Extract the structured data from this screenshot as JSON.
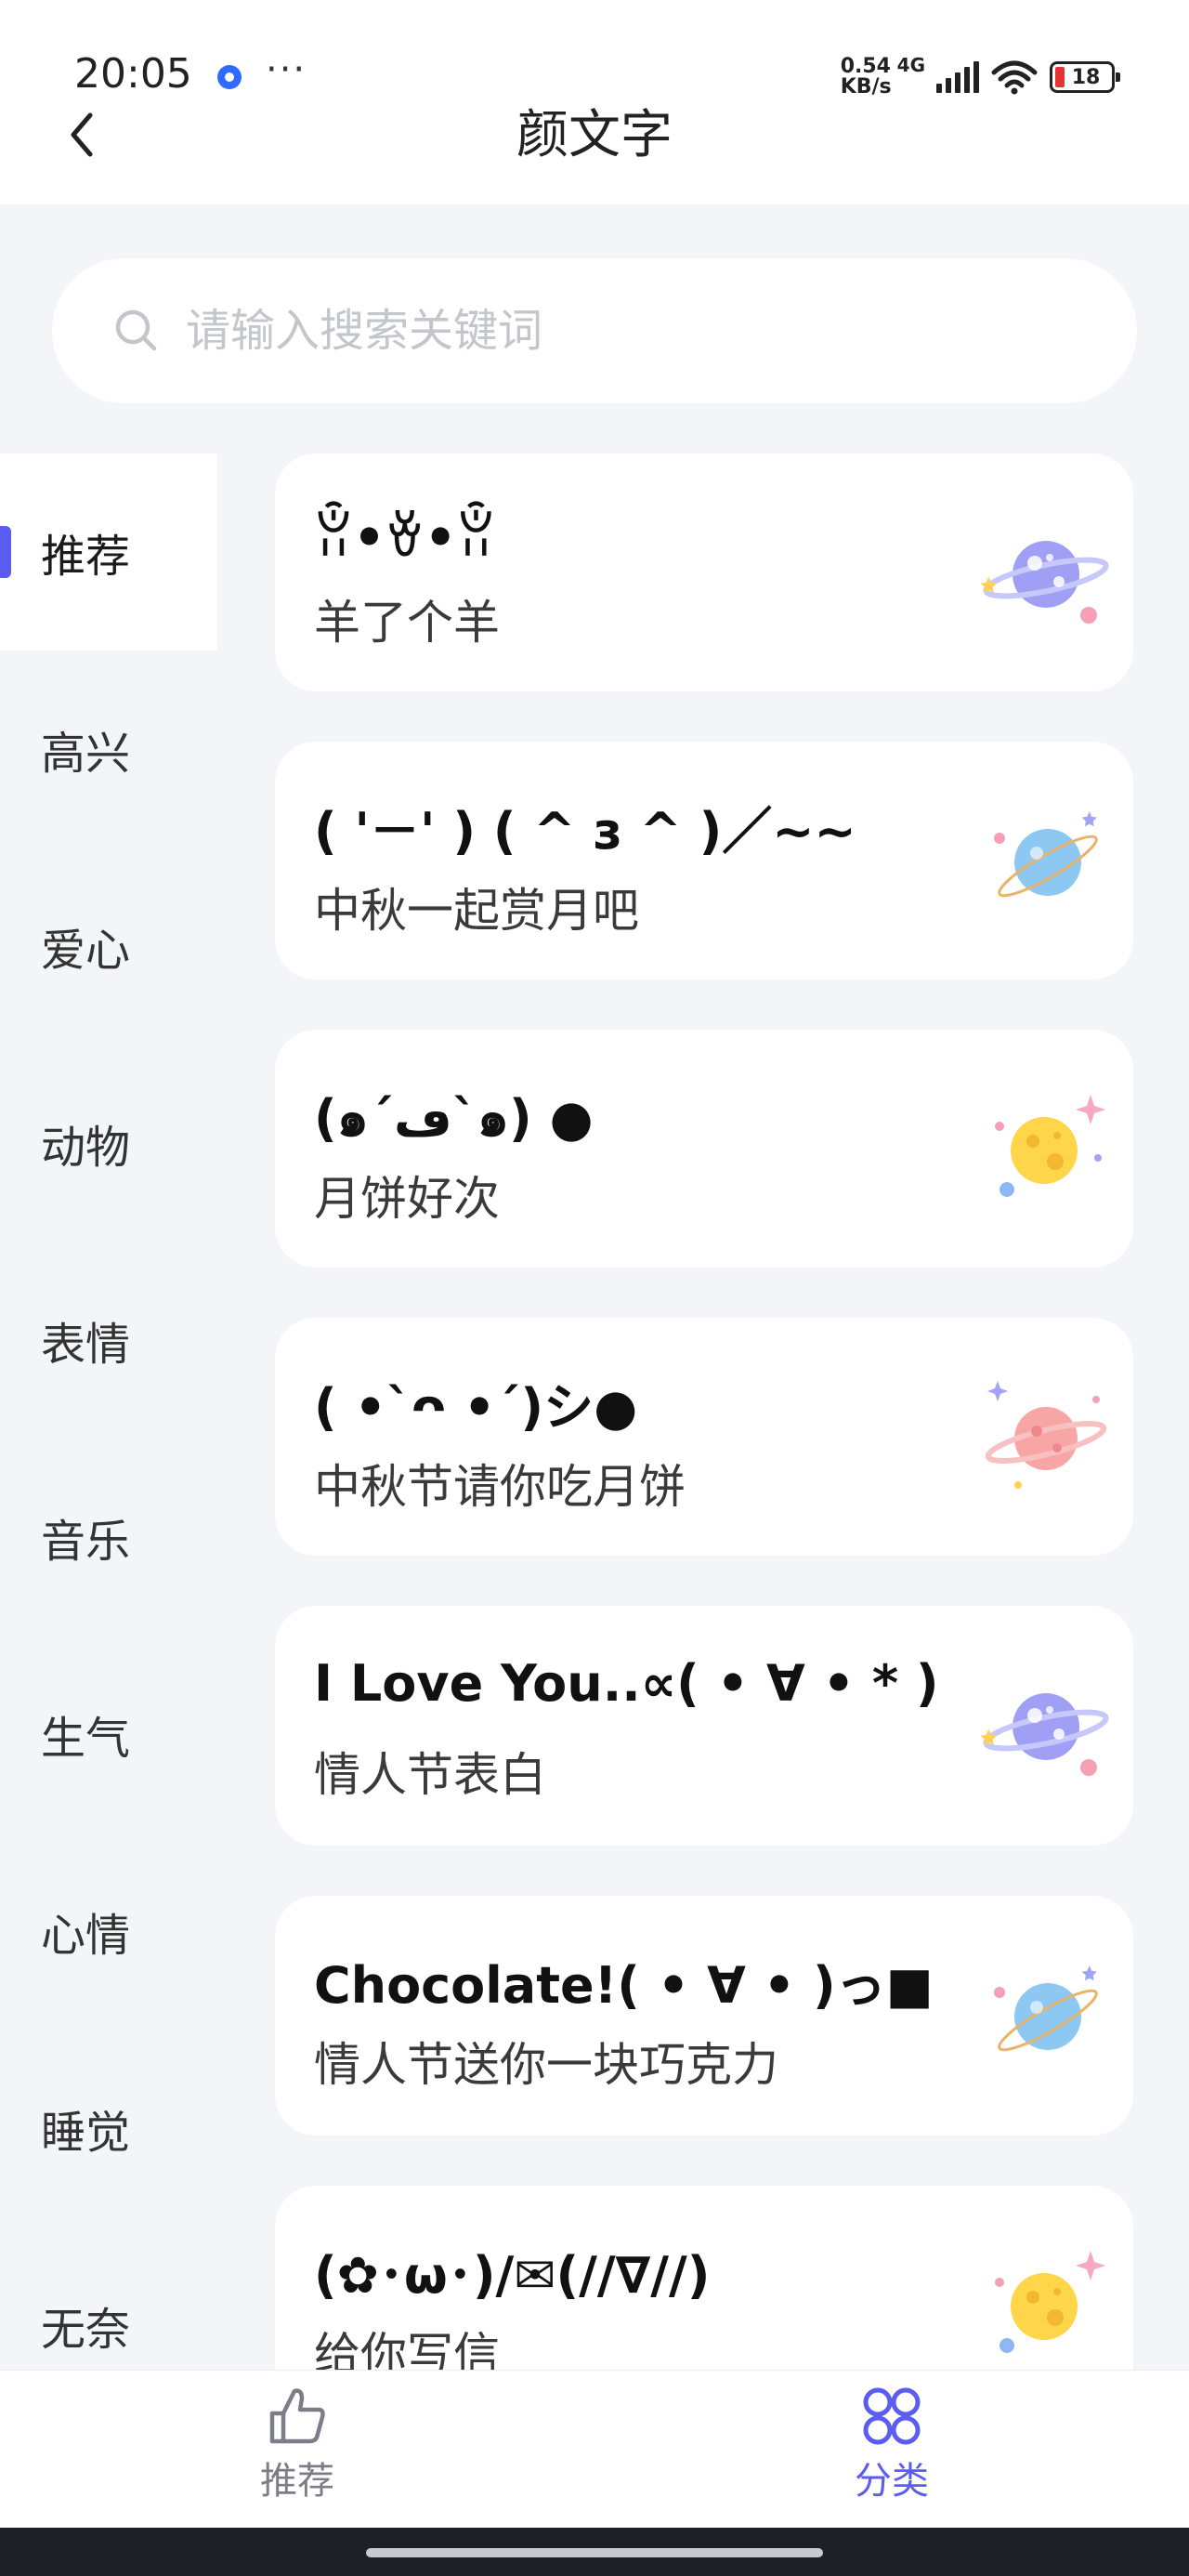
{
  "status_bar": {
    "time": "20:05",
    "more": "···",
    "net_speed_value": "0.54",
    "net_speed_unit": "KB/s",
    "network": "4G",
    "battery": "18"
  },
  "header": {
    "title": "颜文字",
    "back_icon": "chevron-left-icon"
  },
  "search": {
    "placeholder": "请输入搜索关键词",
    "value": "",
    "icon": "search-icon"
  },
  "sidebar": {
    "active_color": "#5b5cf0",
    "items": [
      {
        "label": "推荐"
      },
      {
        "label": "高兴"
      },
      {
        "label": "爱心"
      },
      {
        "label": "动物"
      },
      {
        "label": "表情"
      },
      {
        "label": "音乐"
      },
      {
        "label": "生气"
      },
      {
        "label": "心情"
      },
      {
        "label": "睡觉"
      },
      {
        "label": "无奈"
      }
    ]
  },
  "cards": [
    {
      "emoticon": "ꂧ•ꈊ•ꂧ",
      "desc": "羊了个羊",
      "icon": "purple-planet-icon"
    },
    {
      "emoticon": "( '－' ) ( ^ з ^ )／~~",
      "desc": "中秋一起赏月吧",
      "icon": "blue-planet-icon"
    },
    {
      "emoticon": "(๑´ڡ`๑) ●",
      "desc": "月饼好次",
      "icon": "moon-icon"
    },
    {
      "emoticon": "( •`ᴖ •´)シ●",
      "desc": "中秋节请你吃月饼",
      "icon": "pink-planet-icon"
    },
    {
      "emoticon": "I Love You..∝( • ∀ •  * )",
      "desc": "情人节表白",
      "icon": "purple-planet-icon"
    },
    {
      "emoticon": "Chocolate!( • ∀ • )っ■",
      "desc": "情人节送你一块巧克力",
      "icon": "blue-planet-icon"
    },
    {
      "emoticon": "(✿･ω･)/✉(//∇//)",
      "desc": "给你写信",
      "icon": "moon-icon"
    }
  ],
  "bottom_nav": {
    "items": [
      {
        "label": "推荐",
        "icon": "thumbs-up-icon",
        "active": false
      },
      {
        "label": "分类",
        "icon": "category-grid-icon",
        "active": true
      }
    ]
  }
}
